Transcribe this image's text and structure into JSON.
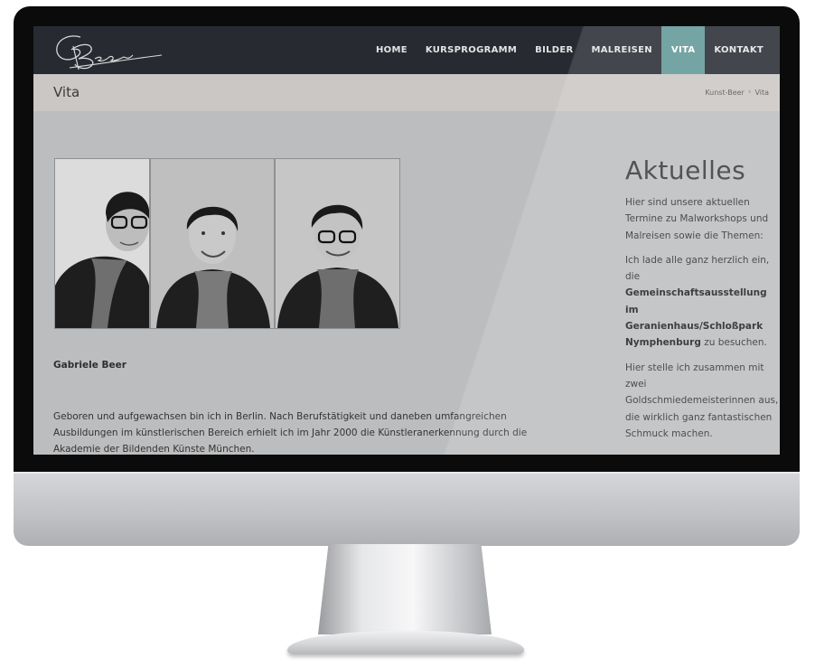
{
  "brand": {
    "logo_text": "G. Beer"
  },
  "nav": {
    "items": [
      {
        "label": "HOME",
        "active": false
      },
      {
        "label": "KURSPROGRAMM",
        "active": false
      },
      {
        "label": "BILDER",
        "active": false
      },
      {
        "label": "MALREISEN",
        "active": false
      },
      {
        "label": "VITA",
        "active": true
      },
      {
        "label": "KONTAKT",
        "active": false
      }
    ]
  },
  "title_bar": {
    "title": "Vita",
    "breadcrumb": [
      "Kunst-Beer",
      "Vita"
    ],
    "breadcrumb_sep": "›"
  },
  "main": {
    "author_name": "Gabriele Beer",
    "bio_lines": [
      "Geboren und aufgewachsen bin ich in Berlin. Nach Berufstätigkeit und daneben umfangreichen",
      "Ausbildungen im künstlerischen Bereich erhielt ich im Jahr 2000  die Künstleranerkennung durch die",
      "Akademie der Bildenden Künste München."
    ]
  },
  "sidebar": {
    "title": "Aktuelles",
    "p1": "Hier sind unsere  aktuellen Termine zu Malworkshops und Malreisen sowie die Themen:",
    "p2_pre": "Ich lade alle ganz herzlich ein, die",
    "p2_bold": "Gemeinschaftsausstellung im Geranienhaus/Schloßpark Nymphenburg",
    "p2_post": " zu besuchen.",
    "p3": "Hier stelle ich zusammen mit zwei Goldschmiedemeisterinnen aus, die wirklich ganz fantastischen Schmuck machen."
  },
  "colors": {
    "navbar": "#272b31",
    "nav_active": "#5f9897",
    "title_bar": "#cac7c4",
    "content_bg": "#bcbdbf"
  }
}
